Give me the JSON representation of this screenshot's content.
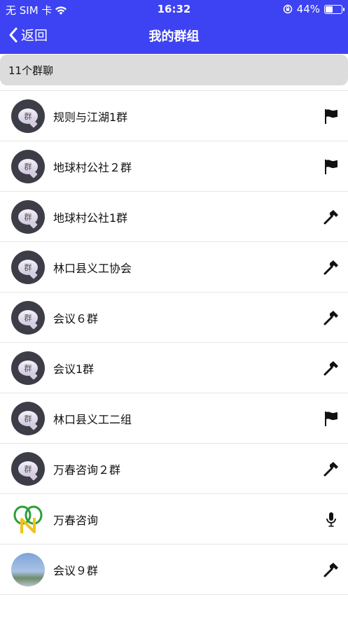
{
  "status_bar": {
    "carrier": "无 SIM 卡",
    "time": "16:32",
    "battery": "44%",
    "battery_level": 0.44
  },
  "nav": {
    "back_label": "返回",
    "title": "我的群组"
  },
  "group_header": "11个群聊",
  "avatar_glyph": "群",
  "groups": [
    {
      "name": "规则与江湖1群",
      "avatar": "group-bubble",
      "status_icon": "flag-icon"
    },
    {
      "name": "地球村公社２群",
      "avatar": "group-bubble",
      "status_icon": "flag-icon"
    },
    {
      "name": "地球村公社1群",
      "avatar": "group-bubble",
      "status_icon": "hammer-icon"
    },
    {
      "name": "林口县义工协会",
      "avatar": "group-bubble",
      "status_icon": "hammer-icon"
    },
    {
      "name": "会议６群",
      "avatar": "group-bubble",
      "status_icon": "hammer-icon"
    },
    {
      "name": "会议1群",
      "avatar": "group-bubble",
      "status_icon": "hammer-icon"
    },
    {
      "name": "林口县义工二组",
      "avatar": "group-bubble",
      "status_icon": "flag-icon"
    },
    {
      "name": "万春咨询２群",
      "avatar": "group-bubble",
      "status_icon": "hammer-icon"
    },
    {
      "name": "万春咨询",
      "avatar": "logo",
      "status_icon": "microphone-icon"
    },
    {
      "name": "会议９群",
      "avatar": "photo",
      "status_icon": "hammer-icon"
    }
  ],
  "colors": {
    "nav_background": "#3d43f2",
    "header_background": "#dcdcdc"
  }
}
